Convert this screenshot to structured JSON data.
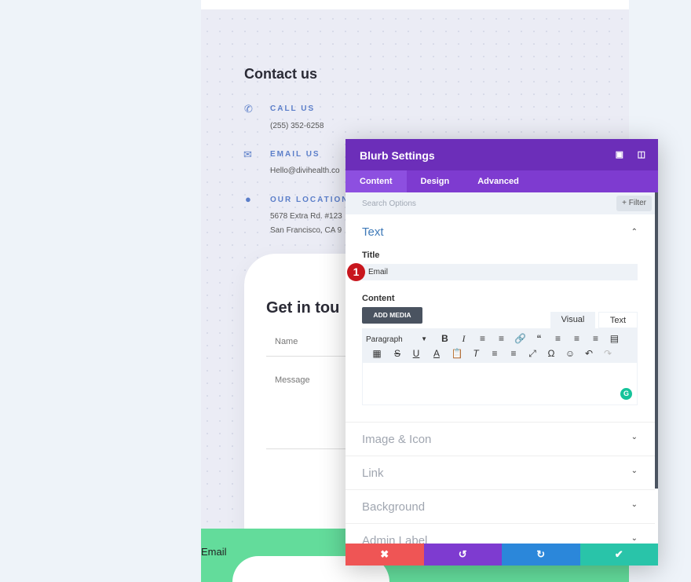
{
  "contact": {
    "title": "Contact us",
    "items": [
      {
        "icon": "phone-icon",
        "label": "CALL US",
        "lines": [
          "(255) 352-6258"
        ]
      },
      {
        "icon": "envelope-icon",
        "label": "EMAIL US",
        "lines": [
          "Hello@divihealth.co"
        ]
      },
      {
        "icon": "location-pin-icon",
        "label": "OUR LOCATION",
        "lines": [
          "5678 Extra Rd. #123",
          "San Francisco, CA 9"
        ]
      }
    ]
  },
  "form": {
    "title": "Get in tou",
    "name_placeholder": "Name",
    "message_placeholder": "Message"
  },
  "footer_text": "Email",
  "panel": {
    "title": "Blurb Settings",
    "tabs": [
      "Content",
      "Design",
      "Advanced"
    ],
    "search_placeholder": "Search Options",
    "filter_label": "+ Filter",
    "text_section": "Text",
    "title_label": "Title",
    "title_value": "Email",
    "badge": "1",
    "content_label": "Content",
    "add_media": "ADD MEDIA",
    "editor_tabs": [
      "Visual",
      "Text"
    ],
    "format_select": "Paragraph",
    "sections": [
      "Image & Icon",
      "Link",
      "Background",
      "Admin Label"
    ]
  },
  "colors": {
    "header": "#6c2eb9",
    "tabs": "#7e3bd0",
    "cancel": "#ef5555",
    "undo": "#7e3bd0",
    "redo": "#2b87da",
    "save": "#29c4a9",
    "accent": "#5b7ec9",
    "wave": "#63dc9b"
  }
}
